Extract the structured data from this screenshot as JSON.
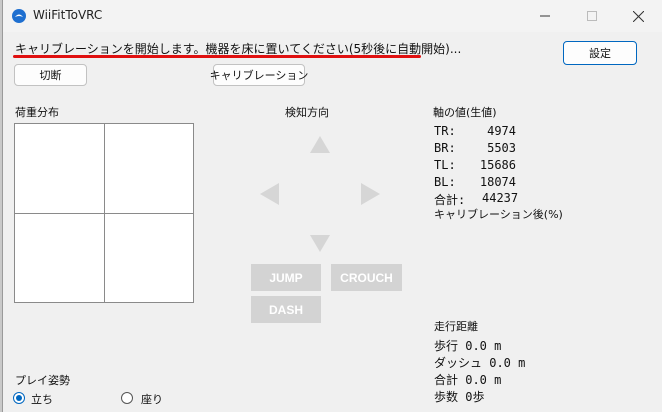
{
  "window": {
    "title": "WiiFitToVRC"
  },
  "status": {
    "message": "キャリブレーションを開始します。機器を床に置いてください(5秒後に自動開始)..."
  },
  "buttons": {
    "disconnect": "切断",
    "calibrate": "キャリブレーション",
    "settings": "設定"
  },
  "weight_distribution": {
    "label": "荷重分布"
  },
  "direction": {
    "label": "検知方向",
    "jump": "JUMP",
    "crouch": "CROUCH",
    "dash": "DASH"
  },
  "axis_values": {
    "label": "軸の値(生値)",
    "rows": [
      {
        "key": "TR:",
        "value": "4974"
      },
      {
        "key": "BR:",
        "value": "5503"
      },
      {
        "key": "TL:",
        "value": "15686"
      },
      {
        "key": "BL:",
        "value": "18074"
      }
    ],
    "total_key": "合計:",
    "total_value": "44237",
    "after_calibration": "キャリブレーション後(%)"
  },
  "distance": {
    "label": "走行距離",
    "walk": "歩行 0.0 m",
    "dash": "ダッシュ 0.0 m",
    "total": "合計 0.0 m",
    "steps": "歩数 0歩"
  },
  "posture": {
    "label": "プレイ姿勢",
    "standing": "立ち",
    "sitting": "座り",
    "selected": "standing"
  },
  "colors": {
    "accent": "#0067c0",
    "underline": "#e01010",
    "disabled": "#d3d3d3"
  }
}
